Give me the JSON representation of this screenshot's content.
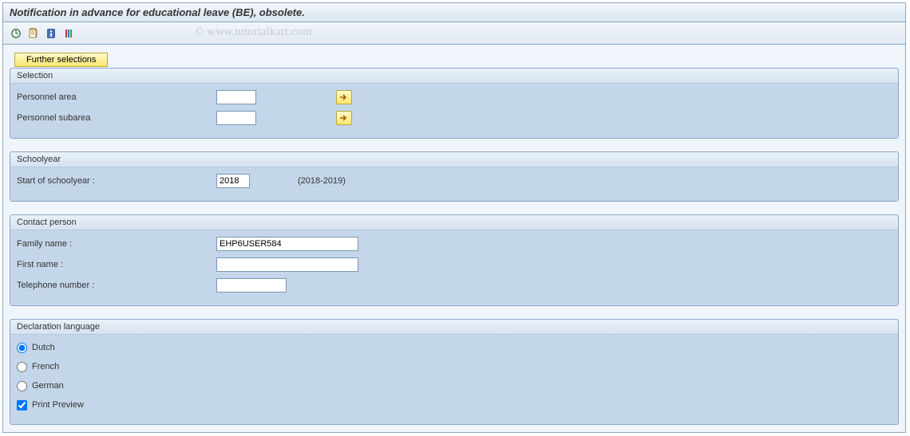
{
  "title": "Notification in advance for educational leave (BE), obsolete.",
  "watermark": "© www.tutorialkart.com",
  "furtherSelections": "Further selections",
  "groups": {
    "selection": {
      "title": "Selection",
      "personnelArea": {
        "label": "Personnel area",
        "value": ""
      },
      "personnelSubarea": {
        "label": "Personnel subarea",
        "value": ""
      }
    },
    "schoolyear": {
      "title": "Schoolyear",
      "startLabel": "Start of schoolyear :",
      "startValue": "2018",
      "rangeDisplay": "(2018-2019)"
    },
    "contact": {
      "title": "Contact person",
      "familyName": {
        "label": "Family name :",
        "value": "EHP6USER584"
      },
      "firstName": {
        "label": "First name :",
        "value": ""
      },
      "telephone": {
        "label": "Telephone number :",
        "value": ""
      }
    },
    "language": {
      "title": "Declaration language",
      "dutch": "Dutch",
      "french": "French",
      "german": "German",
      "printPreview": "Print Preview"
    }
  }
}
